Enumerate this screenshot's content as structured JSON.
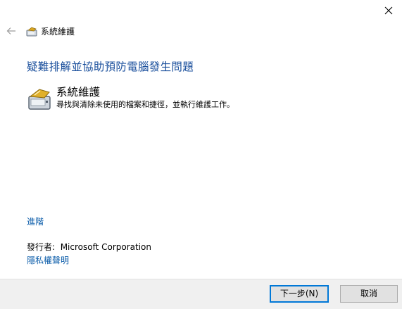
{
  "window": {
    "close_icon": "close-icon"
  },
  "topbar": {
    "back_icon": "back-arrow-icon",
    "app_icon": "maintenance-icon",
    "title": "系統維護"
  },
  "main": {
    "heading": "疑難排解並協助預防電腦發生問題",
    "item": {
      "icon": "maintenance-icon",
      "name": "系統維護",
      "description": "尋找與清除未使用的檔案和捷徑，並執行維護工作。"
    },
    "advanced_link": "進階",
    "publisher_label": "發行者:",
    "publisher_name": "Microsoft Corporation",
    "privacy_link": "隱私權聲明"
  },
  "footer": {
    "next_label": "下一步(N)",
    "cancel_label": "取消"
  },
  "colors": {
    "heading": "#1a4f9c",
    "link": "#0f5fab",
    "focus_border": "#0078d7",
    "footer_bg": "#f0f0f0"
  }
}
